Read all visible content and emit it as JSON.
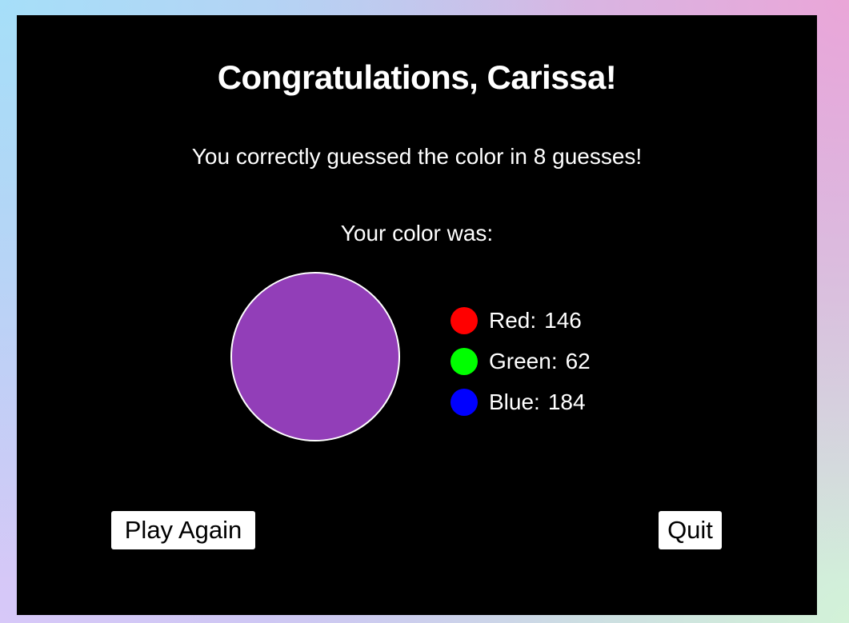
{
  "result": {
    "title": "Congratulations, Carissa!",
    "message": "You correctly guessed the color in 8 guesses!",
    "color_label": "Your color was:",
    "swatch_color": "#923eb8",
    "channels": [
      {
        "label": "Red:",
        "value": "146",
        "dot_color": "#ff0000"
      },
      {
        "label": "Green:",
        "value": "62",
        "dot_color": "#00ff00"
      },
      {
        "label": "Blue:",
        "value": "184",
        "dot_color": "#0000ff"
      }
    ]
  },
  "actions": {
    "play_again_label": "Play Again",
    "quit_label": "Quit"
  },
  "colors": {
    "panel_background": "#000000",
    "text": "#ffffff",
    "button_background": "#ffffff",
    "button_text": "#000000"
  }
}
